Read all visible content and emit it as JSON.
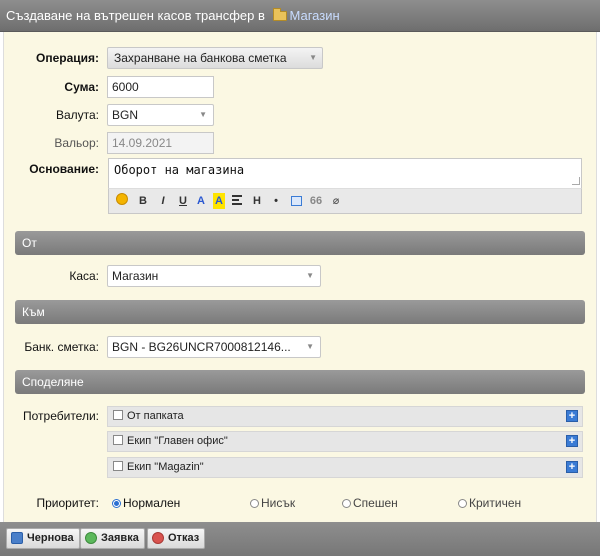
{
  "title": {
    "prefix": "Създаване на вътрешен касов трансфер в",
    "folder_link": "Магазин"
  },
  "form": {
    "operation": {
      "label": "Операция:",
      "value": "Захранване на банкова сметка"
    },
    "amount": {
      "label": "Сума:",
      "value": "6000"
    },
    "currency": {
      "label": "Валута:",
      "value": "BGN"
    },
    "value_date": {
      "label": "Вальор:",
      "value": "14.09.2021"
    },
    "reason": {
      "label": "Основание:",
      "value": "Оборот на магазина"
    }
  },
  "editor_toolbar": {
    "bold": "B",
    "italic": "I",
    "underline": "U",
    "color": "A",
    "highlight": "A",
    "heading": "H",
    "bullet": "•",
    "quote": "66"
  },
  "section_from": {
    "title": "От",
    "cash_label": "Каса:",
    "cash_value": "Магазин"
  },
  "section_to": {
    "title": "Към",
    "bank_label": "Банк. сметка:",
    "bank_value": "BGN - BG26UNCR7000812146..."
  },
  "section_share": {
    "title": "Споделяне",
    "users_label": "Потребители:",
    "groups": [
      "От папката",
      "Екип \"Главен офис\"",
      "Екип \"Magazin\""
    ],
    "priority_label": "Приоритет:",
    "priorities": [
      {
        "label": "Нормален",
        "checked": true
      },
      {
        "label": "Нисък",
        "checked": false
      },
      {
        "label": "Спешен",
        "checked": false
      },
      {
        "label": "Критичен",
        "checked": false
      }
    ]
  },
  "buttons": {
    "draft": "Чернова",
    "request": "Заявка",
    "cancel": "Отказ"
  },
  "colors": {
    "accent_blue": "#2a6fd1",
    "panel_bg": "#fbf8e3",
    "header_gray": "#7a7a7a"
  }
}
